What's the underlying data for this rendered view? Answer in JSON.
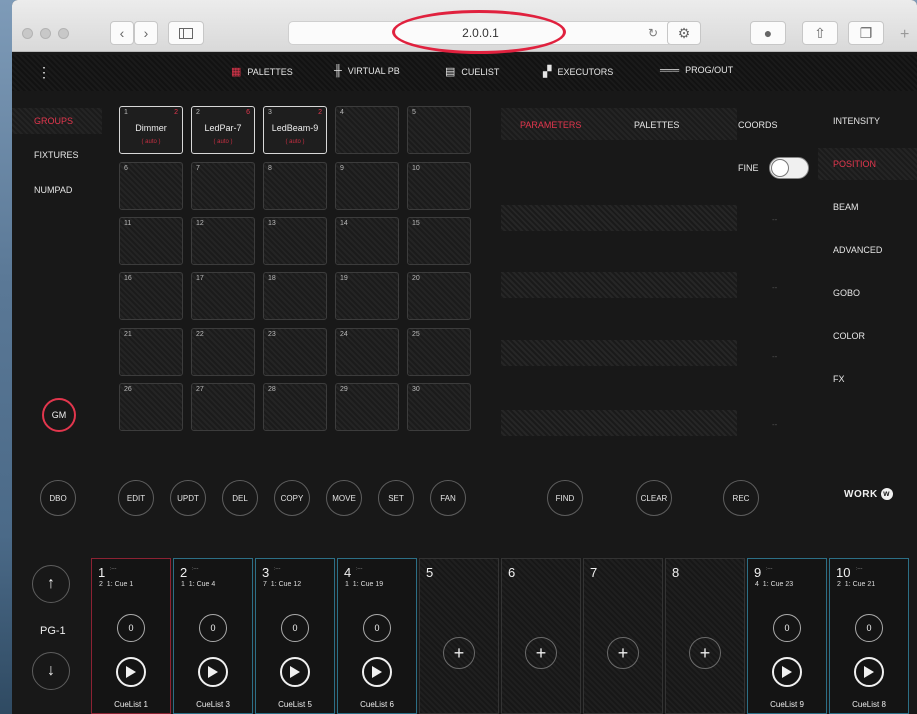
{
  "browser": {
    "url": "2.0.0.1",
    "back_icon": "chevron-left-icon",
    "forward_icon": "chevron-right-icon"
  },
  "nav": {
    "menu_icon": "⋮",
    "palettes": "PALETTES",
    "virtual_pb": "VIRTUAL PB",
    "cuelist": "CUELIST",
    "executors": "EXECUTORS",
    "prog_out": "PROG/OUT"
  },
  "left_menu": [
    "GROUPS",
    "FIXTURES",
    "NUMPAD"
  ],
  "grid": [
    {
      "n": "1",
      "count": "2",
      "name": "Dimmer",
      "sub": "( auto )"
    },
    {
      "n": "2",
      "count": "6",
      "name": "LedPar-7",
      "sub": "( auto )"
    },
    {
      "n": "3",
      "count": "2",
      "name": "LedBeam-9",
      "sub": "( auto )"
    },
    {
      "n": "4"
    },
    {
      "n": "5"
    },
    {
      "n": "6"
    },
    {
      "n": "7"
    },
    {
      "n": "8"
    },
    {
      "n": "9"
    },
    {
      "n": "10"
    },
    {
      "n": "11"
    },
    {
      "n": "12"
    },
    {
      "n": "13"
    },
    {
      "n": "14"
    },
    {
      "n": "15"
    },
    {
      "n": "16"
    },
    {
      "n": "17"
    },
    {
      "n": "18"
    },
    {
      "n": "19"
    },
    {
      "n": "20"
    },
    {
      "n": "21"
    },
    {
      "n": "22"
    },
    {
      "n": "23"
    },
    {
      "n": "24"
    },
    {
      "n": "25"
    },
    {
      "n": "26"
    },
    {
      "n": "27"
    },
    {
      "n": "28"
    },
    {
      "n": "29"
    },
    {
      "n": "30"
    }
  ],
  "gm": "GM",
  "param_tabs": {
    "parameters": "PARAMETERS",
    "palettes": "PALETTES",
    "coords": "COORDS"
  },
  "fine": "FINE",
  "fine_on": true,
  "dashes": [
    "--",
    "--",
    "--",
    "--"
  ],
  "right_menu": [
    "INTENSITY",
    "POSITION",
    "BEAM",
    "ADVANCED",
    "GOBO",
    "COLOR",
    "FX"
  ],
  "buttons": {
    "dbo": "DBO",
    "edit": "EDIT",
    "updt": "UPDT",
    "del": "DEL",
    "copy": "COPY",
    "move": "MOVE",
    "set": "SET",
    "fan": "FAN",
    "find": "FIND",
    "clear": "CLEAR",
    "rec": "REC"
  },
  "logo": "WORK",
  "page": "PG-1",
  "executors": [
    {
      "num": "1",
      "top": ":---",
      "count": "2",
      "cue": "1: Cue 1",
      "knob": "0",
      "label": "CueList 1",
      "border": "#8c2233"
    },
    {
      "num": "2",
      "top": ":---",
      "count": "1",
      "cue": "1: Cue 4",
      "knob": "0",
      "label": "CueList 3",
      "border": "#2c6f86"
    },
    {
      "num": "3",
      "top": ":---",
      "count": "7",
      "cue": "1: Cue 12",
      "knob": "0",
      "label": "CueList 5",
      "border": "#2c6f86"
    },
    {
      "num": "4",
      "top": ":---",
      "count": "1",
      "cue": "1: Cue 19",
      "knob": "0",
      "label": "CueList 6",
      "border": "#2c6f86"
    },
    {
      "num": "5"
    },
    {
      "num": "6"
    },
    {
      "num": "7"
    },
    {
      "num": "8"
    },
    {
      "num": "9",
      "top": ":---",
      "count": "4",
      "cue": "1: Cue 23",
      "knob": "0",
      "label": "CueList 9",
      "border": "#2c6f86"
    },
    {
      "num": "10",
      "top": ":---",
      "count": "2",
      "cue": "1: Cue 21",
      "knob": "0",
      "label": "CueList 8",
      "border": "#2c6f86"
    }
  ],
  "colors": {
    "accent_red": "#e2364d",
    "text": "#e6e6e6"
  }
}
